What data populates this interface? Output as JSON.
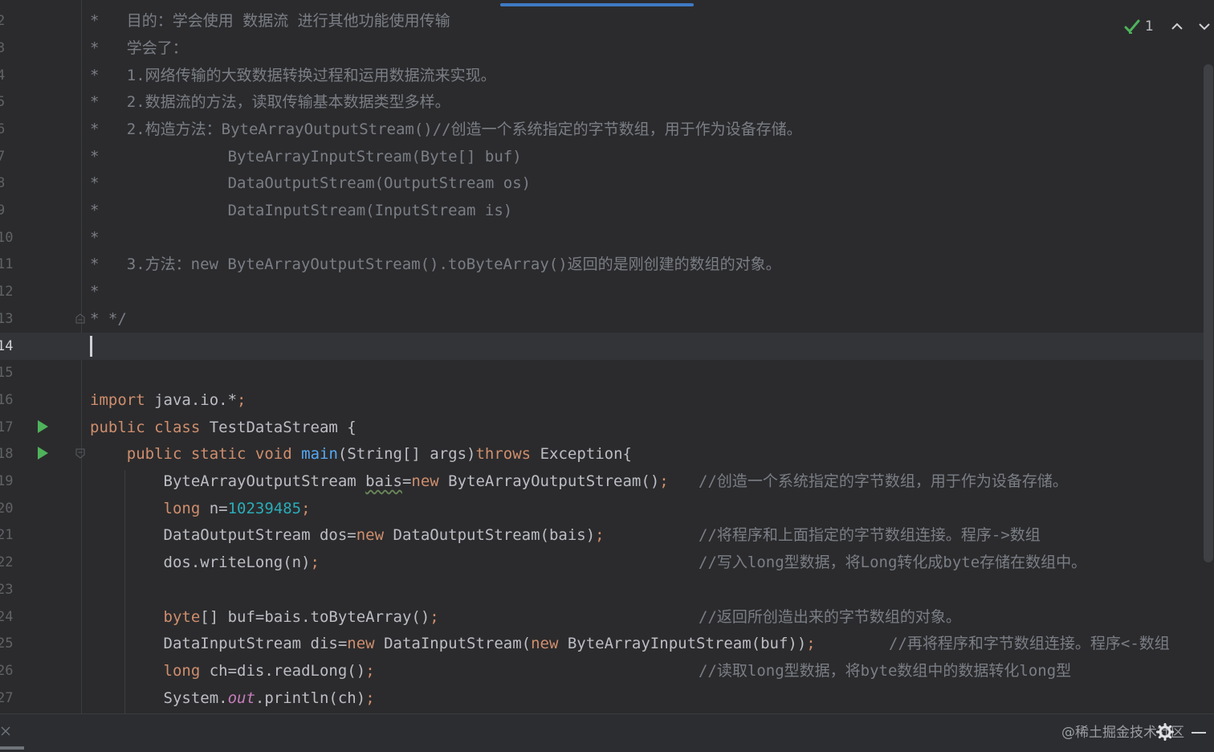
{
  "editor": {
    "lines": [
      {
        "n": "2",
        "text": "*   目的：学会使用 数据流 进行其他功能使用传输"
      },
      {
        "n": "3",
        "text": "*   学会了："
      },
      {
        "n": "4",
        "text": "*   1.网络传输的大致数据转换过程和运用数据流来实现。"
      },
      {
        "n": "5",
        "text": "*   2.数据流的方法，读取传输基本数据类型多样。"
      },
      {
        "n": "6",
        "text": "*   2.构造方法：ByteArrayOutputStream()//创造一个系统指定的字节数组，用于作为设备存储。"
      },
      {
        "n": "7",
        "text": "*              ByteArrayInputStream(Byte[] buf)"
      },
      {
        "n": "8",
        "text": "*              DataOutputStream(OutputStream os)"
      },
      {
        "n": "9",
        "text": "*              DataInputStream(InputStream is)"
      },
      {
        "n": "10",
        "text": "*"
      },
      {
        "n": "11",
        "text": "*   3.方法：new ByteArrayOutputStream().toByteArray()返回的是刚创建的数组的对象。"
      },
      {
        "n": "12",
        "text": "*"
      },
      {
        "n": "13",
        "text": "* */"
      },
      {
        "n": "14",
        "text": ""
      },
      {
        "n": "15",
        "text": ""
      },
      {
        "n": "16",
        "p": [
          "import",
          " java.io.*",
          ";"
        ]
      },
      {
        "n": "17",
        "p": [
          "public class",
          " TestDataStream {"
        ]
      },
      {
        "n": "18",
        "p": [
          "    public static void",
          " ",
          "main",
          "(String[] args)",
          "throws",
          " Exception{"
        ]
      },
      {
        "n": "19",
        "p": [
          "        ByteArrayOutputStream ",
          "bais",
          "=",
          "new",
          " ByteArrayOutputStream()",
          ";"
        ],
        "c": "//创造一个系统指定的字节数组，用于作为设备存储。"
      },
      {
        "n": "20",
        "p": [
          "        ",
          "long",
          " n=",
          "10239485",
          ";"
        ]
      },
      {
        "n": "21",
        "p": [
          "        DataOutputStream dos=",
          "new",
          " DataOutputStream(bais)",
          ";"
        ],
        "c": "//将程序和上面指定的字节数组连接。程序->数组"
      },
      {
        "n": "22",
        "p": [
          "        dos.writeLong(n)",
          ";"
        ],
        "c": "//写入long型数据，将Long转化成byte存储在数组中。"
      },
      {
        "n": "23",
        "text": ""
      },
      {
        "n": "24",
        "p": [
          "        ",
          "byte",
          "[] buf=bais.toByteArray()",
          ";"
        ],
        "c": "//返回所创造出来的字节数组的对象。"
      },
      {
        "n": "25",
        "p": [
          "        DataInputStream dis=",
          "new",
          " DataInputStream(",
          "new",
          " ByteArrayInputStream(buf))",
          ";"
        ],
        "c": "//再将程序和字节数组连接。程序<-数组"
      },
      {
        "n": "26",
        "p": [
          "        ",
          "long",
          " ch=dis.readLong()",
          ";"
        ],
        "c": "//读取long型数据，将byte数组中的数据转化long型"
      },
      {
        "n": "27",
        "p": [
          "        System.",
          "out",
          ".println(ch)",
          ";"
        ]
      }
    ]
  },
  "inspection": {
    "count": "1",
    "icon": "check-double-icon"
  },
  "watermark": "@稀土掘金技术社区",
  "colors": {
    "background": "#2b2b2d",
    "keyword": "#cf8e6d",
    "number": "#2aacb8",
    "method": "#56a8f5",
    "static_field": "#c77dbb",
    "comment": "#7a7e85",
    "run_icon": "#4fb35b"
  }
}
